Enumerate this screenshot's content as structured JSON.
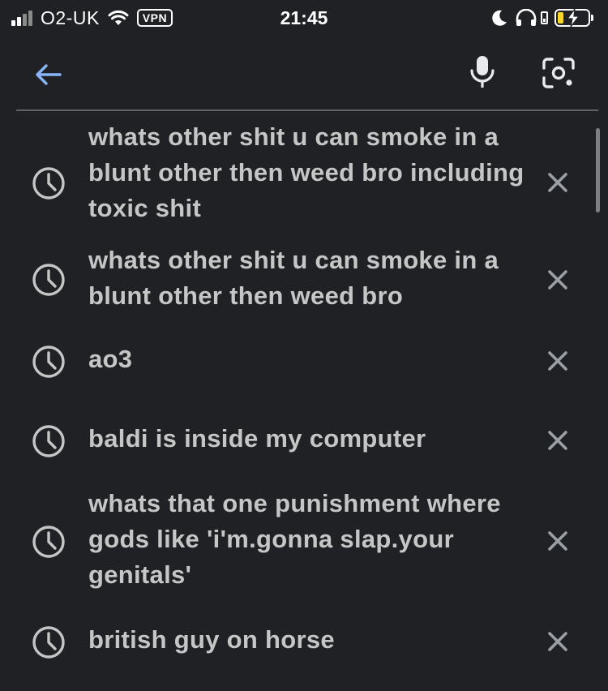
{
  "status_bar": {
    "carrier": "O2-UK",
    "vpn_label": "VPN",
    "time": "21:45",
    "battery_level": 0.2,
    "battery_color": "#f6d72a"
  },
  "header": {
    "back_icon": "arrow-left-icon",
    "mic_icon": "microphone-icon",
    "lens_icon": "camera-search-icon",
    "accent_color": "#8ab4f8"
  },
  "history": [
    {
      "query": "whats other shit u can smoke in a blunt other then weed bro including toxic shit"
    },
    {
      "query": "whats other shit u can smoke in a blunt other then weed bro"
    },
    {
      "query": "ao3"
    },
    {
      "query": "baldi is inside my computer"
    },
    {
      "query": "whats that one punishment where gods like 'i'm.gonna slap.your genitals'"
    },
    {
      "query": "british guy on horse"
    }
  ]
}
